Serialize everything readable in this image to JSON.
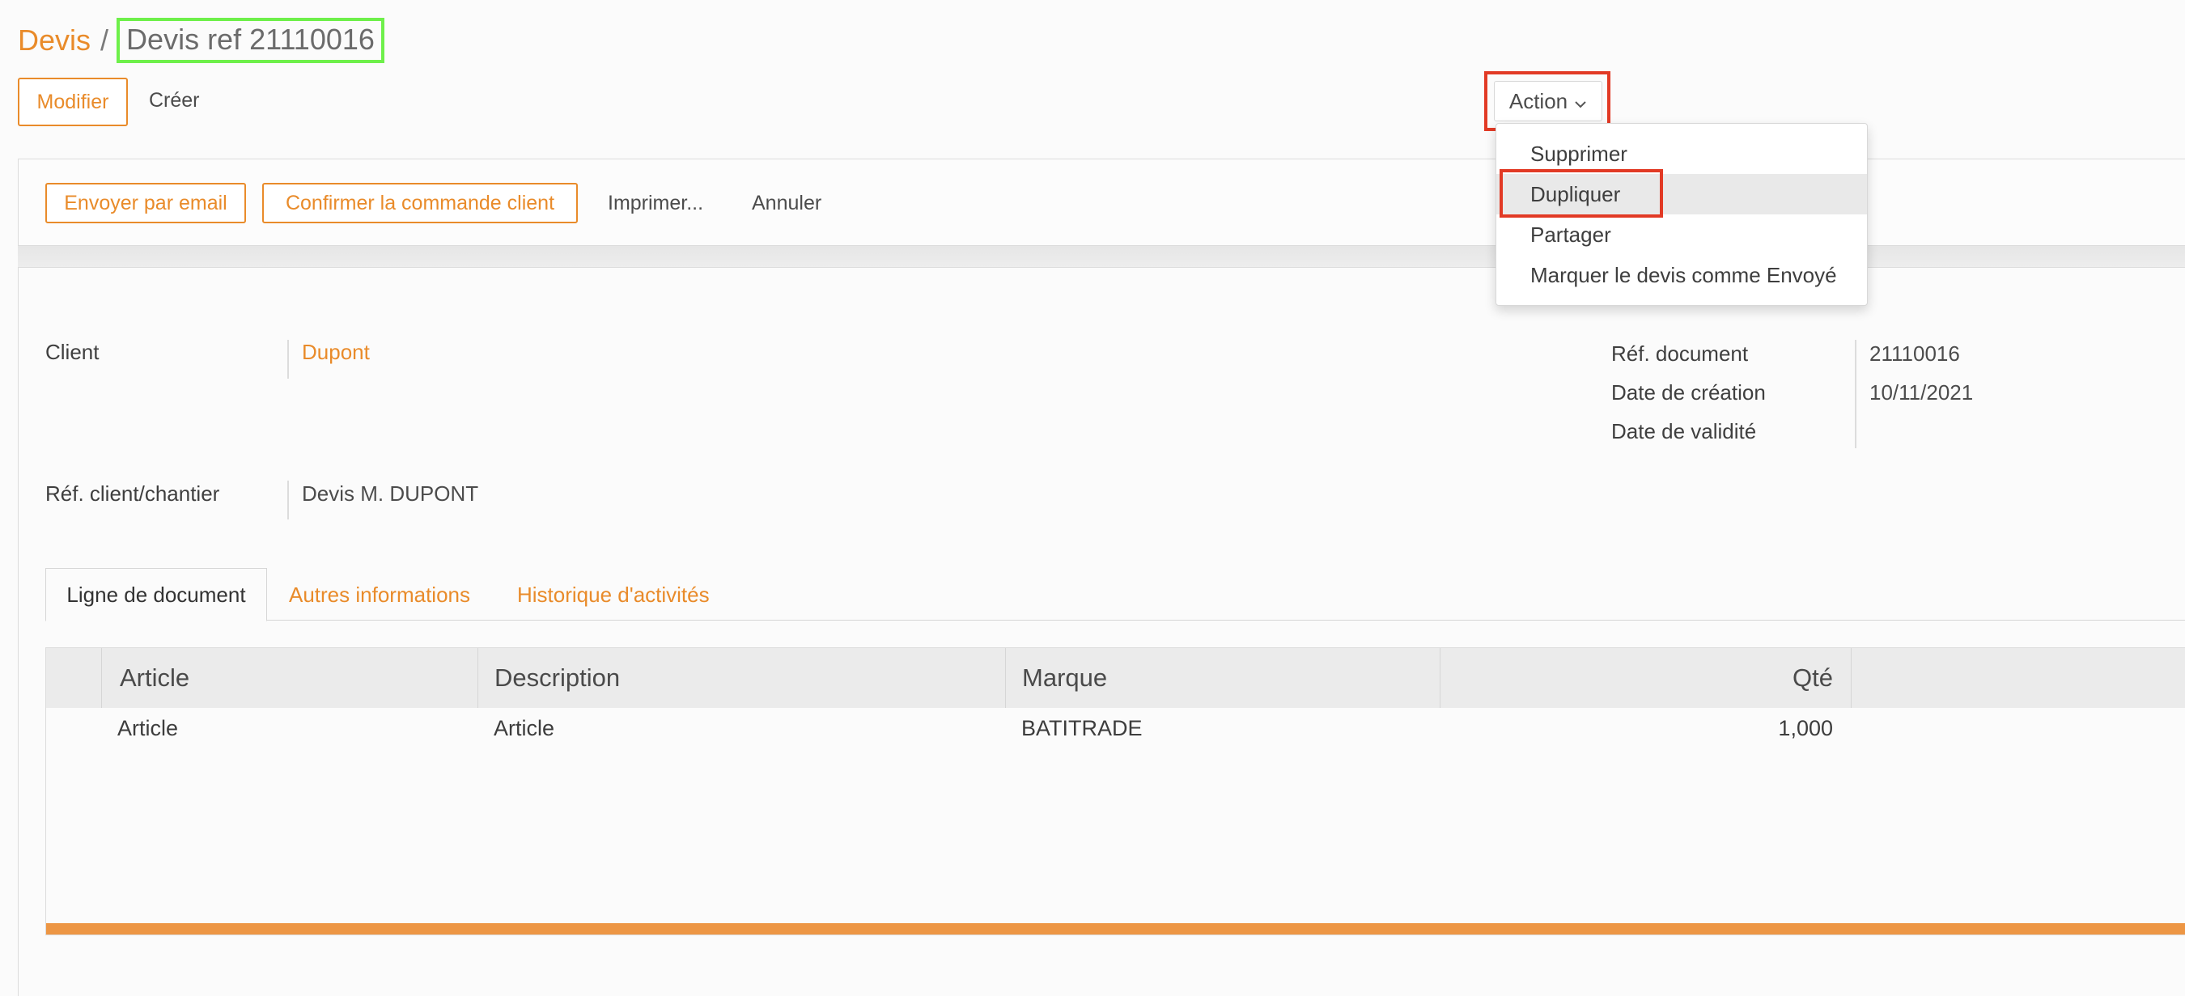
{
  "breadcrumb": {
    "root": "Devis",
    "separator": "/",
    "current": "Devis ref 21110016"
  },
  "toolbar": {
    "edit_label": "Modifier",
    "create_label": "Créer",
    "action_label": "Action"
  },
  "action_menu": {
    "items": [
      {
        "label": "Supprimer"
      },
      {
        "label": "Dupliquer",
        "active": true
      },
      {
        "label": "Partager"
      },
      {
        "label": "Marquer le devis comme Envoyé"
      }
    ]
  },
  "header_buttons": {
    "send_email": "Envoyer par email",
    "confirm_order": "Confirmer la commande client",
    "print": "Imprimer...",
    "cancel": "Annuler"
  },
  "form": {
    "client_label": "Client",
    "client_value": "Dupont",
    "ref_label": "Réf. client/chantier",
    "ref_value": "Devis M. DUPONT",
    "doc_ref_label": "Réf. document",
    "doc_ref_value": "21110016",
    "created_label": "Date de création",
    "created_value": "10/11/2021",
    "validity_label": "Date de validité",
    "validity_value": ""
  },
  "tabs": [
    {
      "label": "Ligne de document",
      "active": true
    },
    {
      "label": "Autres informations"
    },
    {
      "label": "Historique d'activités"
    }
  ],
  "table": {
    "columns": [
      "Article",
      "Description",
      "Marque",
      "Qté"
    ],
    "rows": [
      {
        "article": "Article",
        "description": "Article",
        "marque": "BATITRADE",
        "qte": "1,000"
      }
    ]
  },
  "colors": {
    "accent": "#e98b2a",
    "highlight_red": "#e23a25",
    "highlight_green": "#6ef04a",
    "table_footer": "#ed9644"
  }
}
